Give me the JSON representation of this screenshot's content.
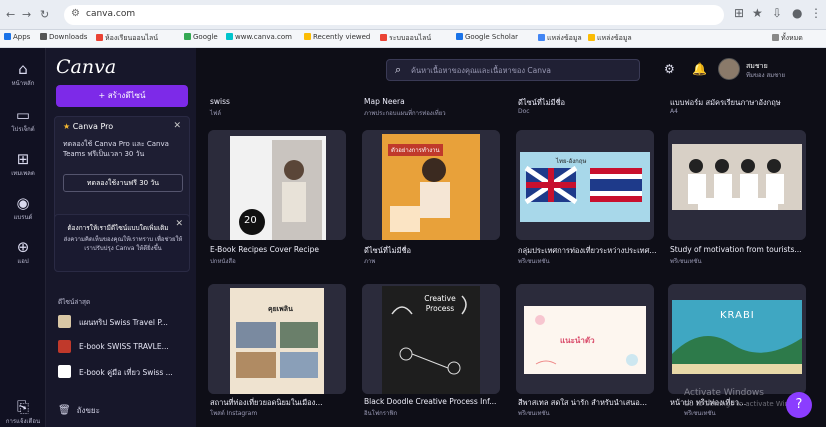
{
  "browser": {
    "url": "canva.com",
    "bookmarks": [
      "Apps",
      "Downloads",
      "ห้องเรียนออนไลน์",
      "Google",
      "www.canva.com",
      "Recently viewed",
      "ระบบออนไลน์",
      "Google Scholar",
      "แหล่งข้อมูล",
      "ทั้งหมด"
    ]
  },
  "rail": {
    "items": [
      {
        "icon": "⌂",
        "label": "หน้าหลัก"
      },
      {
        "icon": "▭",
        "label": "โปรเจ็กต์"
      },
      {
        "icon": "⊞",
        "label": "เทมเพลต"
      },
      {
        "icon": "◉",
        "label": "แบรนด์"
      },
      {
        "icon": "⊕",
        "label": "แอป"
      }
    ],
    "bottom_label": "การแจ้งเตือน"
  },
  "panel": {
    "logo": "Canva",
    "create_label": "+  สร้างดีไซน์",
    "promo": {
      "title": "Canva Pro",
      "text": "ทดลองใช้ Canva Pro และ Canva Teams ฟรีเป็นเวลา 30 วัน",
      "button": "ทดลองใช้งานฟรี 30 วัน"
    },
    "notice": {
      "title": "ต้องการให้เรามีดีไซน์แบบใดเพิ่มเติม",
      "text": "ส่งความคิดเห็นของคุณให้เราทราบ เพื่อช่วยให้เราปรับปรุง Canva ให้ดียิ่งขึ้น"
    },
    "recent_heading": "ดีไซน์ล่าสุด",
    "recent": [
      {
        "label": "แผนทริป Swiss Travel P..."
      },
      {
        "label": "E-book SWISS TRAVLE..."
      },
      {
        "label": "E-book คู่มือ เที่ยว Swiss ..."
      }
    ],
    "trash": "ถังขยะ"
  },
  "topbar": {
    "search_placeholder": "ค้นหาเนื้อหาของคุณและเนื้อหาของ Canva",
    "account_name": "สมชาย",
    "account_sub": "ทีมของ สมชาย"
  },
  "rows": [
    {
      "label": "swiss",
      "sub": "ไฟล์"
    },
    {
      "label": "Map Neera",
      "sub": "ภาพประกอบแผนที่การท่องเที่ยว"
    },
    {
      "label": "ดีไซน์ที่ไม่มีชื่อ",
      "sub": "Doc"
    },
    {
      "label": "แบบฟอร์ม สมัครเรียนภาษาอังกฤษ",
      "sub": "A4"
    }
  ],
  "cards": [
    {
      "title": "E-Book Recipes Cover Recipe",
      "sub": "ปกหนังสือ",
      "badge": "20"
    },
    {
      "title": "ดีไซน์ที่ไม่มีชื่อ",
      "sub": "ภาพ",
      "banner": "ตัวอย่างการทำงาน"
    },
    {
      "title": "กลุ่มประเทศการท่องเที่ยวระหว่างประเทศ...",
      "sub": "พรีเซนเทชัน",
      "banner": "ไทย-อังกฤษ"
    },
    {
      "title": "Study of motivation from tourists...",
      "sub": "พรีเซนเทชัน"
    },
    {
      "title": "สถานที่ท่องเที่ยวยอดนิยมในเมือง...",
      "sub": "โพสต์ Instagram",
      "banner": "คุยเพลิน"
    },
    {
      "title": "Black Doodle Creative Process Inf...",
      "sub": "อินโฟกราฟิก",
      "banner": "Creative Process"
    },
    {
      "title": "สีพาสเทล สดใส น่ารัก สำหรับนำเสนอ...",
      "sub": "พรีเซนเทชัน",
      "banner": "แนะนำตัว"
    },
    {
      "title": "หน้าปก ทริปท่องเที่ยว...",
      "sub": "พรีเซนเทชัน",
      "banner": "KRABI"
    }
  ],
  "overlay": {
    "watermark_1": "Activate Windows",
    "watermark_2": "Go to Settings to activate Windows.",
    "help": "?"
  }
}
